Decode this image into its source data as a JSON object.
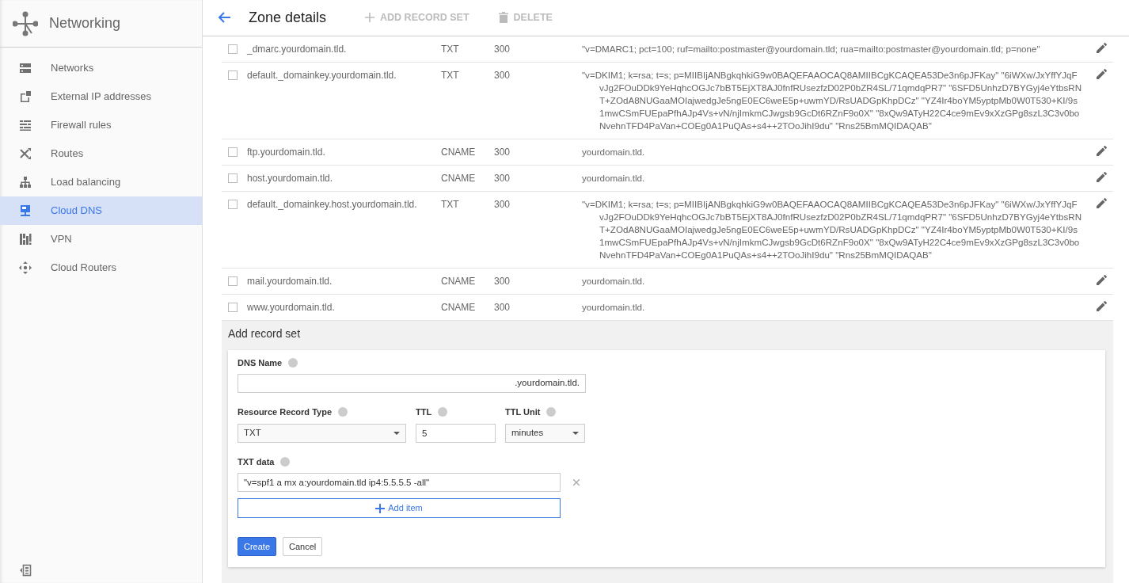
{
  "app": {
    "title": "Networking"
  },
  "sidebar": {
    "items": [
      {
        "label": "Networks",
        "selected": false
      },
      {
        "label": "External IP addresses",
        "selected": false
      },
      {
        "label": "Firewall rules",
        "selected": false
      },
      {
        "label": "Routes",
        "selected": false
      },
      {
        "label": "Load balancing",
        "selected": false
      },
      {
        "label": "Cloud DNS",
        "selected": true
      },
      {
        "label": "VPN",
        "selected": false
      },
      {
        "label": "Cloud Routers",
        "selected": false
      }
    ]
  },
  "header": {
    "title": "Zone details",
    "actions": [
      {
        "label": "ADD RECORD SET",
        "disabled": true
      },
      {
        "label": "DELETE",
        "disabled": true
      }
    ]
  },
  "records": [
    {
      "name": "_dmarc.yourdomain.tld.",
      "type": "TXT",
      "ttl": "300",
      "data": "\"v=DMARC1; pct=100; ruf=mailto:postmaster@yourdomain.tld; rua=mailto:postmaster@yourdomain.tld; p=none\"",
      "checked": false
    },
    {
      "name": "default._domainkey.yourdomain.tld.",
      "type": "TXT",
      "ttl": "300",
      "data": "\"v=DKIM1; k=rsa; t=s; p=MIIBIjANBgkqhkiG9w0BAQEFAAOCAQ8AMIIBCgKCAQEA53De3n6pJFKay\" \"6iWXw/JxYffYJqFvJg2FOuDDk9YeHqhcOGJc7bBT5EjXT8AJ0fnfRUsezfzD02P0bZR4SL/71qmdqPR7\" \"6SFD5UnhzD7BYGyj4eYtbsRNT+ZOdA8NUGaaMOIajwedgJe5ngE0EC6weE5p+uwmYD/RsUADGpKhpDCz\" \"YZ4Ir4boYM5yptpMb0W0T530+KI/9s1mwCSmFUEpaPfhAJp4Vs+vN/njImkmCJwgsb9GcDt6RZnF9o0X\" \"8xQw9ATyH22C4ce9mEv9xXzGPg8szL3C3v0boNvehnTFD4PaVan+COEg0A1PuQAs+s4++2TOoJihI9du\" \"Rns25BmMQIDAQAB\"",
      "checked": false
    },
    {
      "name": "ftp.yourdomain.tld.",
      "type": "CNAME",
      "ttl": "300",
      "data": "yourdomain.tld.",
      "checked": false
    },
    {
      "name": "host.yourdomain.tld.",
      "type": "CNAME",
      "ttl": "300",
      "data": "yourdomain.tld.",
      "checked": false
    },
    {
      "name": "default._domainkey.host.yourdomain.tld.",
      "type": "TXT",
      "ttl": "300",
      "data": "\"v=DKIM1; k=rsa; t=s; p=MIIBIjANBgkqhkiG9w0BAQEFAAOCAQ8AMIIBCgKCAQEA53De3n6pJFKay\" \"6iWXw/JxYffYJqFvJg2FOuDDk9YeHqhcOGJc7bBT5EjXT8AJ0fnfRUsezfzD02P0bZR4SL/71qmdqPR7\" \"6SFD5UnhzD7BYGyj4eYtbsRNT+ZOdA8NUGaaMOIajwedgJe5ngE0EC6weE5p+uwmYD/RsUADGpKhpDCz\" \"YZ4Ir4boYM5yptpMb0W0T530+KI/9s1mwCSmFUEpaPfhAJp4Vs+vN/njImkmCJwgsb9GcDt6RZnF9o0X\" \"8xQw9ATyH22C4ce9mEv9xXzGPg8szL3C3v0boNvehnTFD4PaVan+COEg0A1PuQAs+s4++2TOoJihI9du\" \"Rns25BmMQIDAQAB\"",
      "checked": false
    },
    {
      "name": "mail.yourdomain.tld.",
      "type": "CNAME",
      "ttl": "300",
      "data": "yourdomain.tld.",
      "checked": false
    },
    {
      "name": "www.yourdomain.tld.",
      "type": "CNAME",
      "ttl": "300",
      "data": "yourdomain.tld.",
      "checked": false
    }
  ],
  "add_record_set": {
    "title": "Add record set",
    "dns_name": {
      "label": "DNS Name",
      "suffix": ".yourdomain.tld."
    },
    "record_type": {
      "label": "Resource Record Type",
      "value": "TXT"
    },
    "ttl": {
      "label": "TTL",
      "value": "5"
    },
    "ttl_unit": {
      "label": "TTL Unit",
      "value": "minutes"
    },
    "txt_data": {
      "label": "TXT data",
      "items": [
        "\"v=spf1 a mx a:yourdomain.tld ip4:5.5.5.5 -all\""
      ]
    },
    "add_item": "Add item",
    "buttons": [
      {
        "label": "Create",
        "kind": "primary"
      },
      {
        "label": "Cancel",
        "kind": "secondary"
      }
    ]
  }
}
